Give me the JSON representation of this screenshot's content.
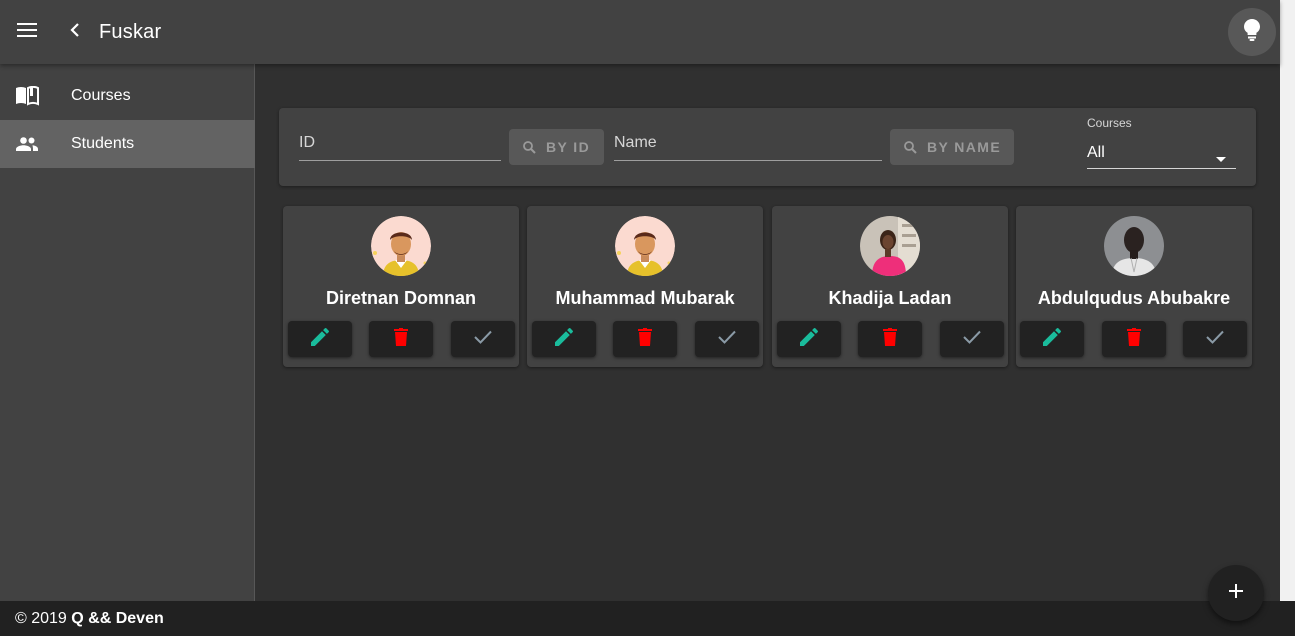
{
  "app": {
    "title": "Fuskar"
  },
  "sidebar": {
    "items": [
      {
        "label": "Courses",
        "icon": "book-icon"
      },
      {
        "label": "Students",
        "icon": "people-icon"
      }
    ]
  },
  "filters": {
    "id_placeholder": "ID",
    "by_id_label": "BY ID",
    "name_placeholder": "Name",
    "by_name_label": "BY NAME",
    "courses_label": "Courses",
    "courses_value": "All"
  },
  "students": [
    {
      "name": "Diretnan Domnan",
      "avatar": "cartoon-avatar"
    },
    {
      "name": "Muhammad Mubarak",
      "avatar": "cartoon-avatar"
    },
    {
      "name": "Khadija Ladan",
      "avatar": "photo-avatar"
    },
    {
      "name": "Abdulqudus Abubakre",
      "avatar": "photo-avatar"
    }
  ],
  "footer": {
    "copyright": "© 2019",
    "authors": "Q && Deven"
  },
  "colors": {
    "edit": "#1abc9c",
    "delete": "#ff0000",
    "approve": "#8a9aa6"
  }
}
